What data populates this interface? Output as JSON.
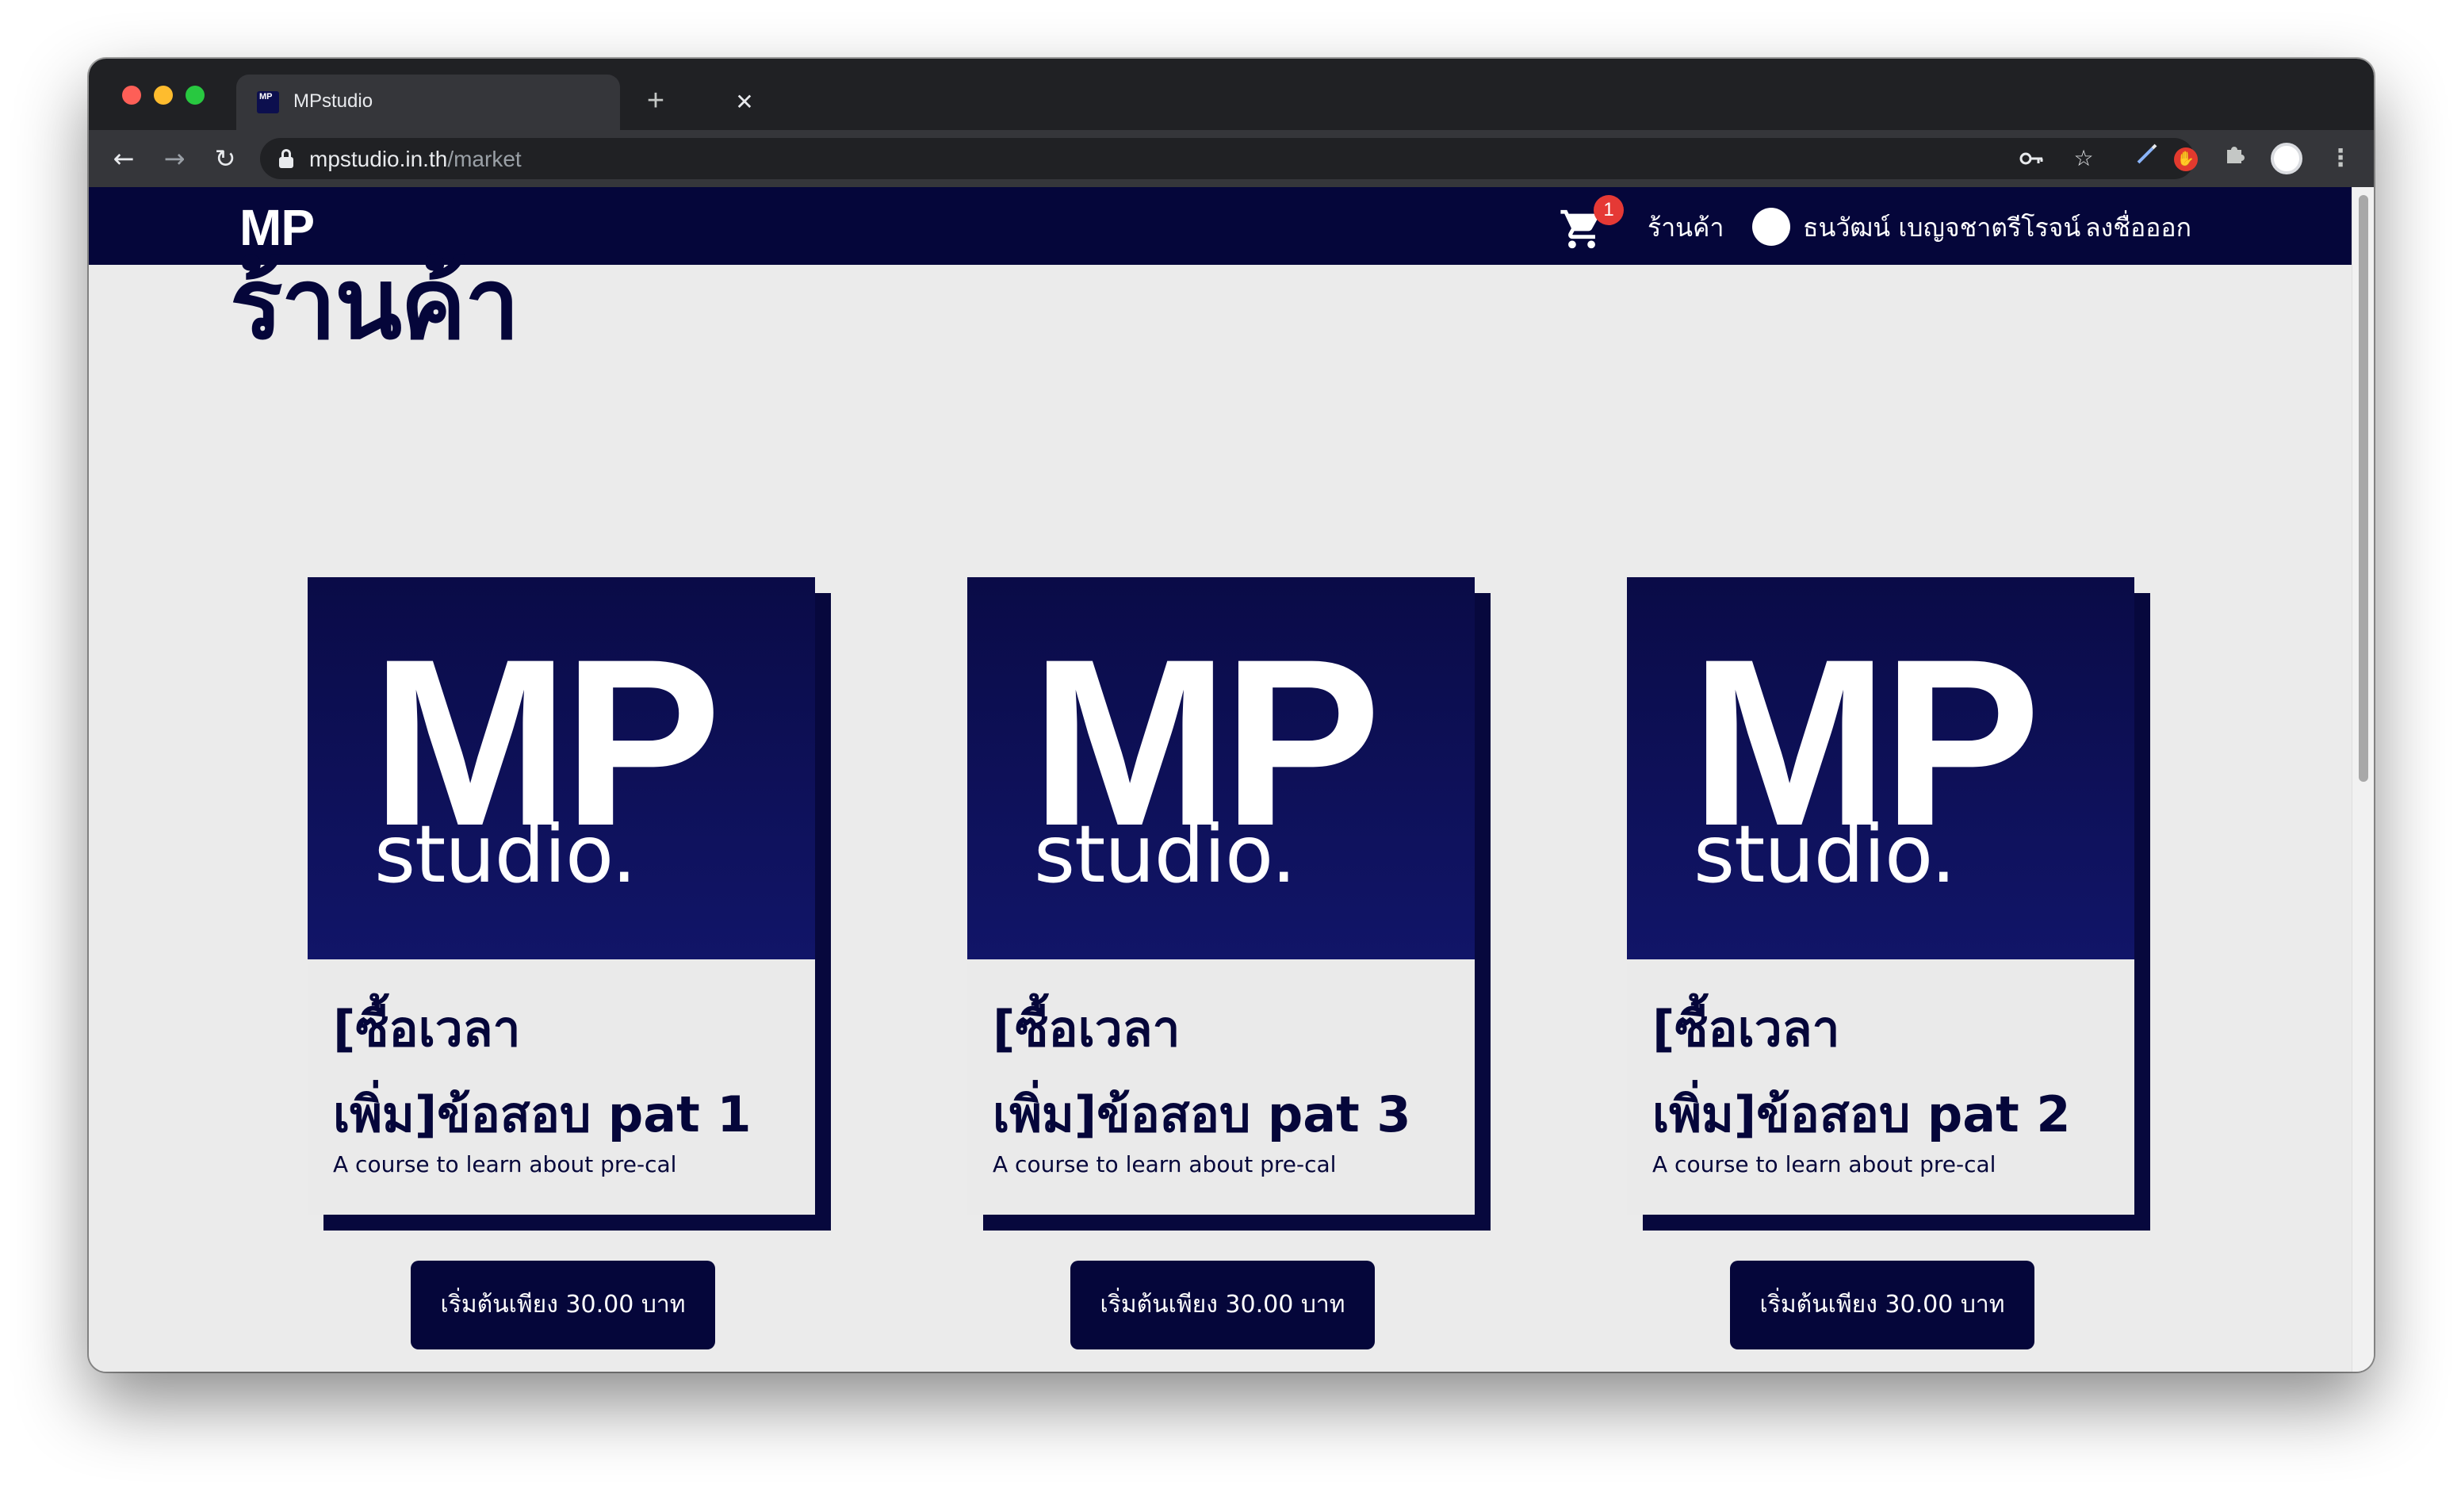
{
  "browser": {
    "tab_title": "MPstudio",
    "favicon_text": "MP",
    "url_host": "mpstudio.in.th",
    "url_path": "/market"
  },
  "navbar": {
    "brand": "MP",
    "cart_count": "1",
    "shop_link": "ร้านค้า",
    "user_name": "ธนวัฒน์ เบญจชาตรีโรจน์",
    "logout_link": "ลงชื่อออก"
  },
  "page": {
    "heading": "ร้านค้า"
  },
  "logo": {
    "mp": "MP",
    "studio": "studio."
  },
  "products": [
    {
      "title_line1": "[ซื้อเวลา",
      "title_line2": "เพิ่ม]ข้อสอบ pat 1",
      "description": "A course to learn about pre-cal",
      "button": "เริ่มต้นเพียง 30.00 บาท"
    },
    {
      "title_line1": "[ซื้อเวลา",
      "title_line2": "เพิ่ม]ข้อสอบ pat 3",
      "description": "A course to learn about pre-cal",
      "button": "เริ่มต้นเพียง 30.00 บาท"
    },
    {
      "title_line1": "[ซื้อเวลา",
      "title_line2": "เพิ่ม]ข้อสอบ pat 2",
      "description": "A course to learn about pre-cal",
      "button": "เริ่มต้นเพียง 30.00 บาท"
    }
  ],
  "colors": {
    "brand_navy": "#05063a",
    "badge_red": "#e53935",
    "page_bg": "#ebebeb"
  }
}
